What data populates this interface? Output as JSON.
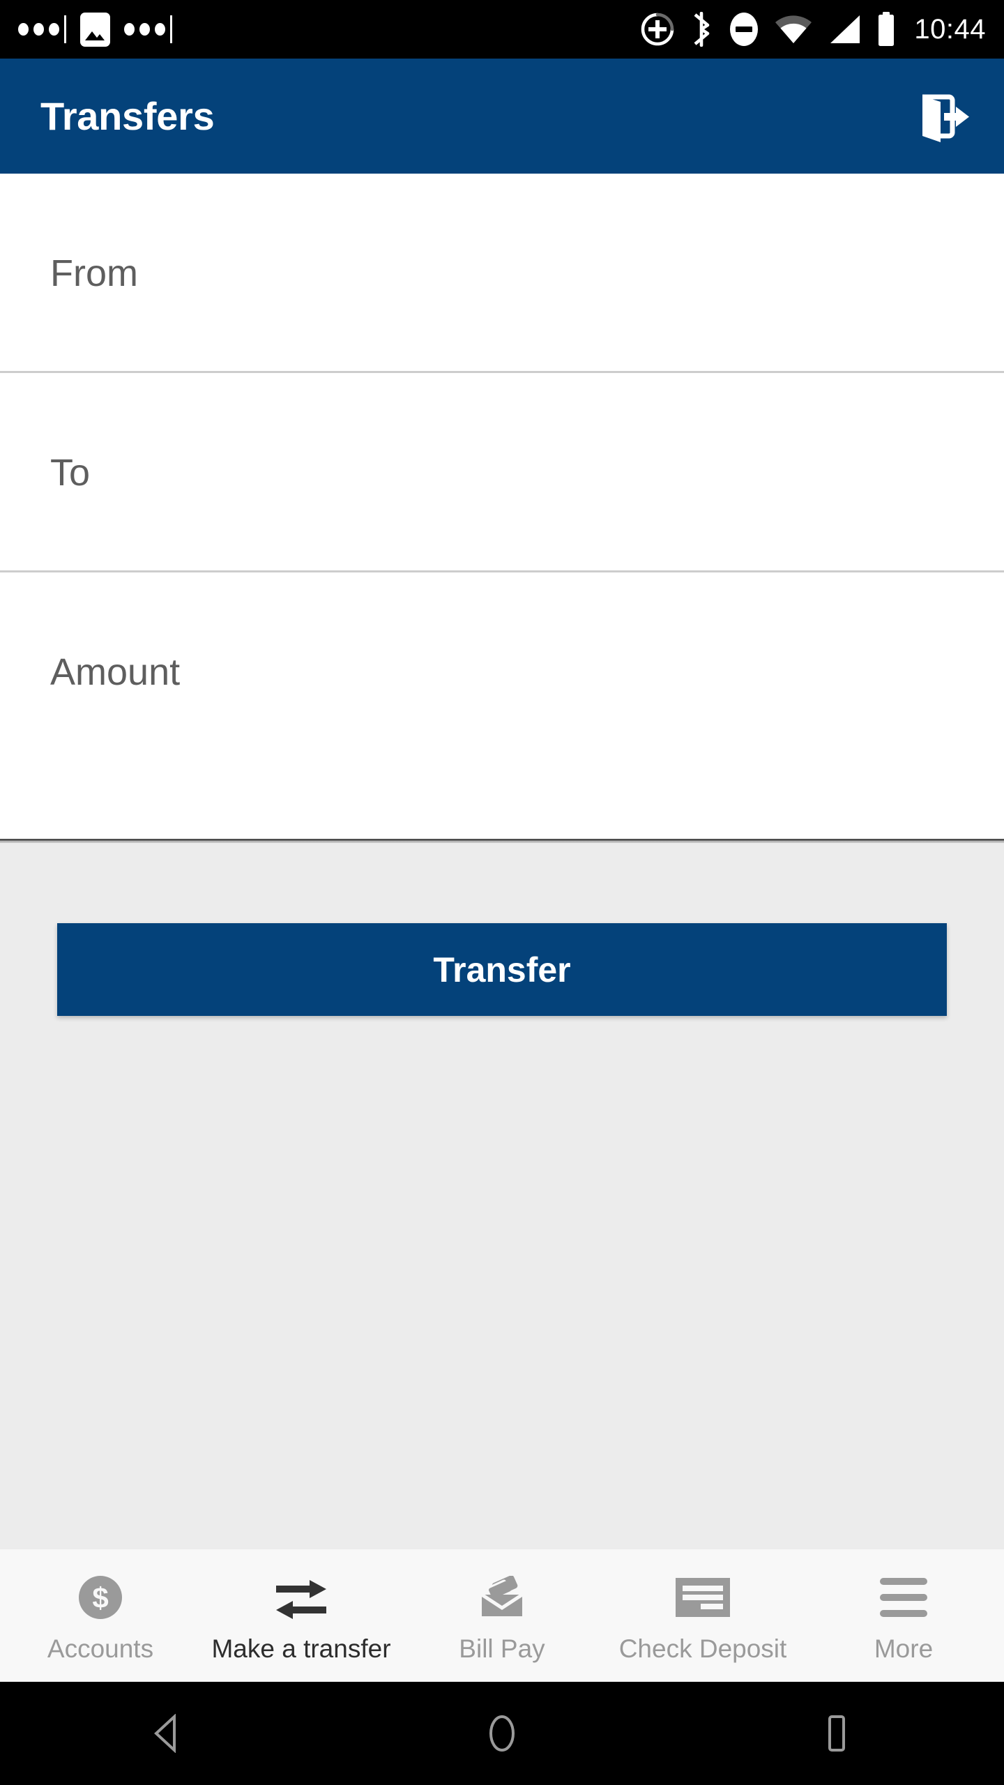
{
  "status_bar": {
    "notification_dots_left": "•••",
    "image_icon": "image-icon",
    "notification_dots_right": "•••",
    "icons": [
      "location-add-icon",
      "bluetooth-icon",
      "do-not-disturb-icon",
      "wifi-icon",
      "cellular-signal-icon",
      "battery-icon"
    ],
    "time": "10:44",
    "background_color": "#000000",
    "foreground_color": "#ffffff"
  },
  "header": {
    "title": "Transfers",
    "logout_icon": "logout-door-arrow-icon",
    "background_color": "#04427a",
    "text_color": "#ffffff"
  },
  "form": {
    "fields": [
      {
        "name": "from",
        "placeholder": "From",
        "value": ""
      },
      {
        "name": "to",
        "placeholder": "To",
        "value": ""
      },
      {
        "name": "amount",
        "placeholder": "Amount",
        "value": ""
      }
    ],
    "placeholder_color": "#5e5e5e",
    "divider_color": "#cdcdcd",
    "background_color": "#ffffff"
  },
  "main": {
    "submit_label": "Transfer",
    "submit_color": "#04427a",
    "background_color": "#ececec"
  },
  "tabbar": {
    "background_color": "#f8f8f8",
    "inactive_color": "#9a9a9a",
    "active_color": "#2d2d2d",
    "tabs": [
      {
        "label": "Accounts",
        "icon": "dollar-circle-icon",
        "active": false
      },
      {
        "label": "Make a transfer",
        "icon": "transfer-arrows-icon",
        "active": true
      },
      {
        "label": "Bill Pay",
        "icon": "envelope-cards-icon",
        "active": false
      },
      {
        "label": "Check Deposit",
        "icon": "check-icon",
        "active": false
      },
      {
        "label": "More",
        "icon": "hamburger-menu-icon",
        "active": false
      }
    ]
  },
  "system_nav": {
    "background_color": "#000000",
    "icon_color": "#9a9a9a",
    "buttons": [
      {
        "name": "back",
        "icon": "back-triangle-icon"
      },
      {
        "name": "home",
        "icon": "home-circle-icon"
      },
      {
        "name": "recents",
        "icon": "recents-square-icon"
      }
    ]
  }
}
